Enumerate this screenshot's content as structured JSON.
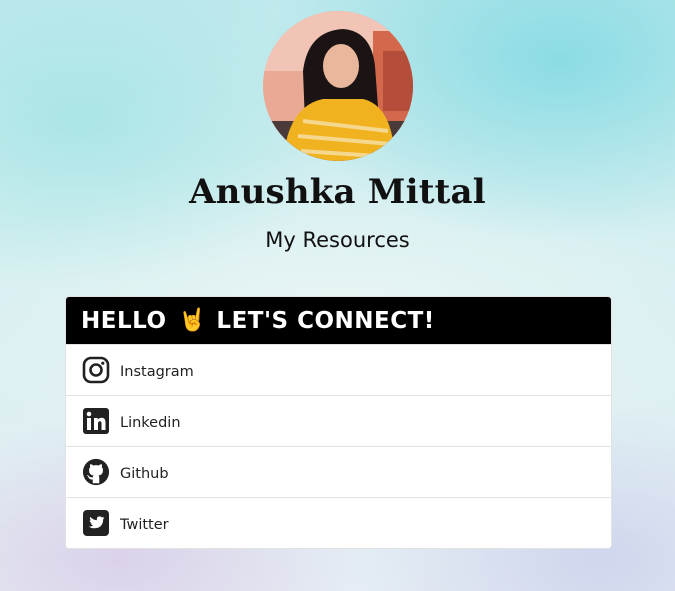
{
  "profile": {
    "name": "Anushka Mittal",
    "subtitle": "My Resources"
  },
  "card": {
    "header_left": "HELLO",
    "header_icon": "rock-on-hand-icon",
    "header_emoji": "🤘",
    "header_right": "LET'S CONNECT!"
  },
  "links": [
    {
      "label": "Instagram",
      "icon": "instagram-icon"
    },
    {
      "label": "Linkedin",
      "icon": "linkedin-icon"
    },
    {
      "label": "Github",
      "icon": "github-icon"
    },
    {
      "label": "Twitter",
      "icon": "twitter-icon"
    }
  ],
  "colors": {
    "header_bg": "#000000",
    "card_bg": "#ffffff",
    "icon": "#222222"
  }
}
